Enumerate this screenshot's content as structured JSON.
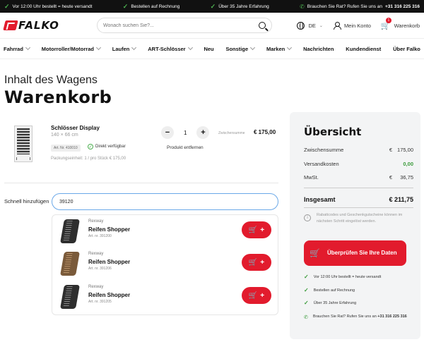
{
  "topbar": {
    "item1": "Vor 12:00 Uhr bestellt = heute versandt",
    "item2": "Bestellen auf Rechnung",
    "item3": "Über 35 Jahre Erfahrung",
    "item4_prefix": "Brauchen Sie Rat? Rufen Sie uns an",
    "item4_phone": "+31 316 225 316"
  },
  "header": {
    "logo": "FALKO",
    "search_placeholder": "Wonach suchen Sie?...",
    "language": "DE",
    "account": "Mein Konto",
    "cart": "Warenkorb",
    "cart_count": "1"
  },
  "nav": {
    "items": [
      "Fahrrad",
      "Motorroller/Motorrad",
      "Laufen",
      "ART-Schlösser",
      "Neu",
      "Sonstige",
      "Marken",
      "Nachrichten",
      "Kundendienst",
      "Über Falko"
    ]
  },
  "page": {
    "subtitle": "Inhalt des Wagens",
    "title": "Warenkorb"
  },
  "cart_item": {
    "name": "Schlösser Display",
    "size": "140 × 66 cm",
    "art_nr": "Art. Nr. 410010",
    "stock": "Direkt verfügbar",
    "packaging": "Packungseinheit: 1 / pro Stück € 175,00",
    "qty_minus": "−",
    "qty": "1",
    "qty_plus": "+",
    "remove": "Produkt entfernen",
    "subtotal_label": "Zwischensumme",
    "subtotal": "€ 175,00"
  },
  "quick_add": {
    "label": "Schnell hinzufügen",
    "value": "39120",
    "results": [
      {
        "brand": "Rexway",
        "name": "Reifen Shopper",
        "art": "Art. nr. 391200"
      },
      {
        "brand": "Rexway",
        "name": "Reifen Shopper",
        "art": "Art. nr. 391206"
      },
      {
        "brand": "Rexway",
        "name": "Reifen Shopper",
        "art": "Art. nr. 391205"
      }
    ],
    "add_plus": "+"
  },
  "summary": {
    "title": "Übersicht",
    "rows": [
      {
        "label": "Zwischensumme",
        "cur": "€",
        "value": "175,00"
      },
      {
        "label": "Versandkosten",
        "cur": "",
        "value": "0,00"
      },
      {
        "label": "MwSt.",
        "cur": "€",
        "value": "36,75"
      }
    ],
    "total_label": "Insgesamt",
    "total": "€ 211,75",
    "info": "Rabattcodes und Geschenkgutscheine können im nächsten Schritt eingelöst werden.",
    "cta": "Überprüfen Sie Ihre Daten",
    "perks": [
      "Vor 12:00 Uhr bestellt = heute versandt",
      "Bestellen auf Rechnung",
      "Über 35 Jahre Erfahrung"
    ],
    "contact_prefix": "Brauchen Sie Rat? Rufen Sie uns an",
    "contact_phone": "+31 316 225 316"
  },
  "colors": {
    "brand": "#e21b2d",
    "success": "#3a9b3a",
    "topbar": "#111111",
    "panel": "#f3f4f5"
  },
  "icons": [
    "check-icon",
    "phone-icon",
    "search-icon",
    "globe-icon",
    "user-icon",
    "cart-icon",
    "chevron-down-icon",
    "info-icon"
  ]
}
